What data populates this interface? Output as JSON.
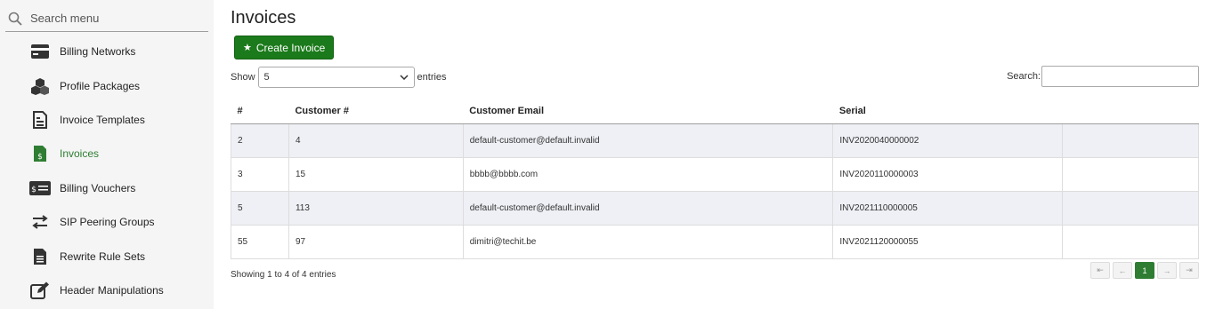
{
  "sidebar": {
    "search_placeholder": "Search menu",
    "items": [
      {
        "label": "Billing Networks",
        "icon": "billing-networks-icon"
      },
      {
        "label": "Profile Packages",
        "icon": "profile-packages-icon"
      },
      {
        "label": "Invoice Templates",
        "icon": "invoice-templates-icon"
      },
      {
        "label": "Invoices",
        "icon": "invoices-icon",
        "active": true
      },
      {
        "label": "Billing Vouchers",
        "icon": "billing-vouchers-icon"
      },
      {
        "label": "SIP Peering Groups",
        "icon": "sip-peering-groups-icon"
      },
      {
        "label": "Rewrite Rule Sets",
        "icon": "rewrite-rule-sets-icon"
      },
      {
        "label": "Header Manipulations",
        "icon": "header-manipulations-icon"
      }
    ]
  },
  "main": {
    "title": "Invoices",
    "create_button": "Create Invoice",
    "show_label": "Show",
    "show_value": "5",
    "entries_label": "entries",
    "search_label": "Search:",
    "columns": [
      "#",
      "Customer #",
      "Customer Email",
      "Serial",
      ""
    ],
    "rows": [
      [
        "2",
        "4",
        "default-customer@default.invalid",
        "INV2020040000002",
        ""
      ],
      [
        "3",
        "15",
        "bbbb@bbbb.com",
        "INV2020110000003",
        ""
      ],
      [
        "5",
        "113",
        "default-customer@default.invalid",
        "INV2021110000005",
        ""
      ],
      [
        "55",
        "97",
        "dimitri@techit.be",
        "INV2021120000055",
        ""
      ]
    ],
    "info": "Showing 1 to 4 of 4 entries",
    "pagination": {
      "first": "⇤",
      "prev": "←",
      "current": "1",
      "next": "→",
      "last": "⇥"
    }
  },
  "colors": {
    "accent": "#2e7d32",
    "button": "#1b7a1b",
    "row_alt": "#eef0f5"
  }
}
